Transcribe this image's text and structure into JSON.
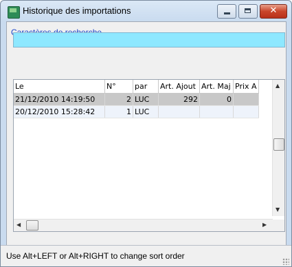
{
  "window": {
    "title": "Historique des importations",
    "close_glyph": "✕"
  },
  "search": {
    "group_label": "Caractères de recherche",
    "value": ""
  },
  "grid": {
    "columns": [
      "Le",
      "N°",
      "par",
      "Art. Ajout",
      "Art. Maj",
      "Prix A"
    ],
    "rows": [
      {
        "le": "21/12/2010 14:19:50",
        "n": "2",
        "par": "LUC",
        "ajout": "292",
        "maj": "0",
        "prix": ""
      },
      {
        "le": "20/12/2010 15:28:42",
        "n": "1",
        "par": "LUC",
        "ajout": "",
        "maj": "",
        "prix": ""
      }
    ]
  },
  "status": {
    "text": "Use Alt+LEFT or Alt+RIGHT to change sort order"
  },
  "colors": {
    "search_field_bg": "#8ee8ff",
    "selected_row_bg": "#c8c8c8",
    "group_label_color": "#1a45c8"
  },
  "icons": [
    "app-icon",
    "minimize-icon",
    "maximize-icon",
    "close-icon",
    "scroll-up-icon",
    "scroll-down-icon",
    "scroll-left-icon",
    "scroll-right-icon",
    "resize-grip-icon"
  ]
}
